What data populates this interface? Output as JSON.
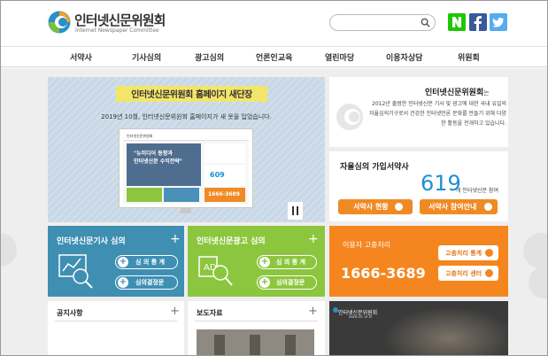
{
  "header": {
    "logo_title": "인터넷신문위원회",
    "logo_subtitle": "Internet Newspaper Committee",
    "search_placeholder": ""
  },
  "nav": [
    "서약사",
    "기사심의",
    "광고심의",
    "언론인교육",
    "열린마당",
    "이용자상담",
    "위원회"
  ],
  "banner": {
    "title": "인터넷신문위원회 홈페이지 새단장",
    "description": "2019년 10월, 인터넷신문위원회 홈페이지가 새 옷을 입었습니다.",
    "screen_logo": "인터넷신문위원회",
    "screen_headline_1": "\"뉴미디어 동향과",
    "screen_headline_2": "인터넷신문 수익전략\"",
    "screen_count": "609",
    "screen_phone": "1666-3689"
  },
  "committee": {
    "title": "인터넷신문위원회",
    "title_suffix": "는",
    "text": "2012년 출범한 인터넷신문 기사 및 광고에 대한 국내 유일의 자율심의기구로서 건강한 인터넷언론 문화를 만들기 위해 다양한 활동을 전개하고 있습니다."
  },
  "self_regulation": {
    "title": "자율심의 가입서약사",
    "count": "619",
    "unit": "개 인터넷신문 참여",
    "btn_status": "서약사 현황",
    "btn_guide": "서약사 참여안내"
  },
  "article_review": {
    "title": "인터넷신문기사 심의",
    "btn_stats": "심 의 통 계",
    "btn_decisions": "심의결정문"
  },
  "ad_review": {
    "title": "인터넷신문광고 심의",
    "btn_stats": "심 의 통 계",
    "btn_decisions": "심의결정문"
  },
  "complaint": {
    "label": "이용자 고충처리",
    "phone": "1666-3689",
    "btn_stats": "고충처리 통계",
    "btn_center": "고충처리 센터"
  },
  "notice": {
    "title": "공지사항"
  },
  "press": {
    "title": "보도자료"
  },
  "video": {
    "logo": "인터넷신문위원회",
    "url": "www.inc.or.kr"
  },
  "colors": {
    "blue": "#3f8fb3",
    "green": "#8cc63f",
    "orange": "#f5861f",
    "accent_number": "#1e90d2"
  }
}
